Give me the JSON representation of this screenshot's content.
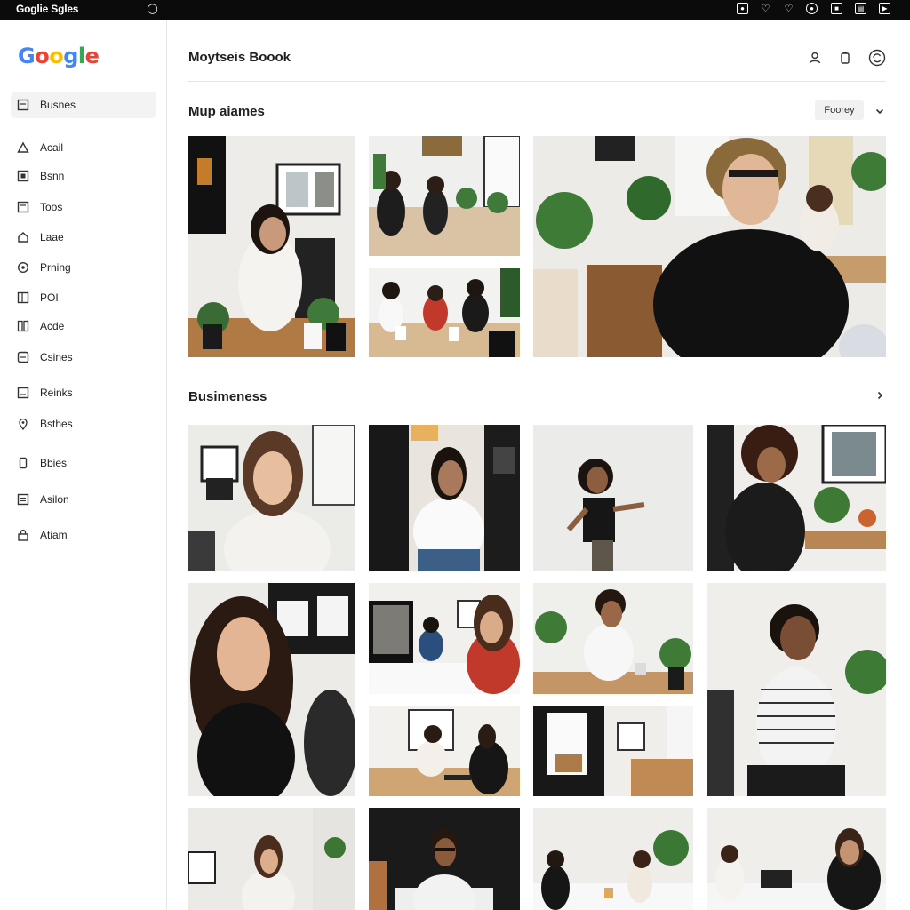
{
  "window": {
    "title": "Goglie Sgles",
    "topbar_icons": [
      "sync-icon",
      "shield-icon",
      "heart-icon",
      "heart-icon",
      "settings-icon",
      "image-icon",
      "panel-icon",
      "close-icon"
    ]
  },
  "sidebar": {
    "logo": "Google",
    "items": [
      {
        "label": "Busnes",
        "icon": "square-icon",
        "active": true
      },
      {
        "label": "Acail",
        "icon": "triangle-icon"
      },
      {
        "label": "Bsnn",
        "icon": "square-icon"
      },
      {
        "label": "Toos",
        "icon": "square-icon"
      },
      {
        "label": "Laae",
        "icon": "home-icon"
      },
      {
        "label": "Prning",
        "icon": "circle-icon"
      },
      {
        "label": "POI",
        "icon": "square-icon"
      },
      {
        "label": "Acde",
        "icon": "grid-icon"
      },
      {
        "label": "Csines",
        "icon": "square-icon"
      },
      {
        "label": "Reinks",
        "icon": "square-icon"
      },
      {
        "label": "Bsthes",
        "icon": "pin-icon"
      },
      {
        "label": "Bbies",
        "icon": "phone-icon"
      },
      {
        "label": "Asilon",
        "icon": "square-icon"
      },
      {
        "label": "Atiam",
        "icon": "lock-icon"
      }
    ]
  },
  "header": {
    "title": "Moytseis Boook",
    "icons": [
      "person-icon",
      "clipboard-icon",
      "sync-icon"
    ]
  },
  "section1": {
    "title": "Mup aiames",
    "filter_label": "Foorey"
  },
  "section2": {
    "title": "Busimeness"
  },
  "colors": {
    "accent": "#1a73e8",
    "topbar": "#0b0b0b",
    "active_item_bg": "#f3f3f3"
  }
}
